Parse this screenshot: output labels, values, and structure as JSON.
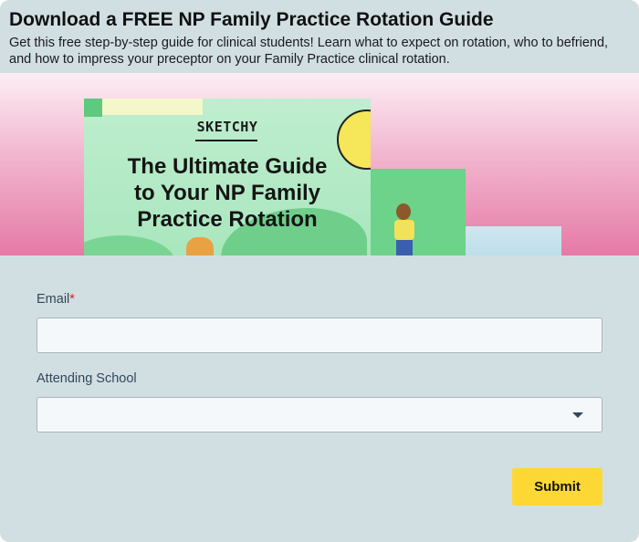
{
  "header": {
    "title": "Download a FREE NP Family Practice Rotation Guide",
    "subtitle": "Get this free step-by-step guide for clinical students! Learn what to expect on rotation, who to befriend, and how to impress your preceptor on your Family Practice clinical rotation."
  },
  "banner": {
    "brand": "SKETCHY",
    "cover_title_lines": [
      "The Ultimate Guide",
      "to Your NP Family",
      "Practice Rotation"
    ]
  },
  "form": {
    "email": {
      "label": "Email",
      "required_mark": "*",
      "value": ""
    },
    "school": {
      "label": "Attending School",
      "value": ""
    },
    "submit_label": "Submit"
  }
}
